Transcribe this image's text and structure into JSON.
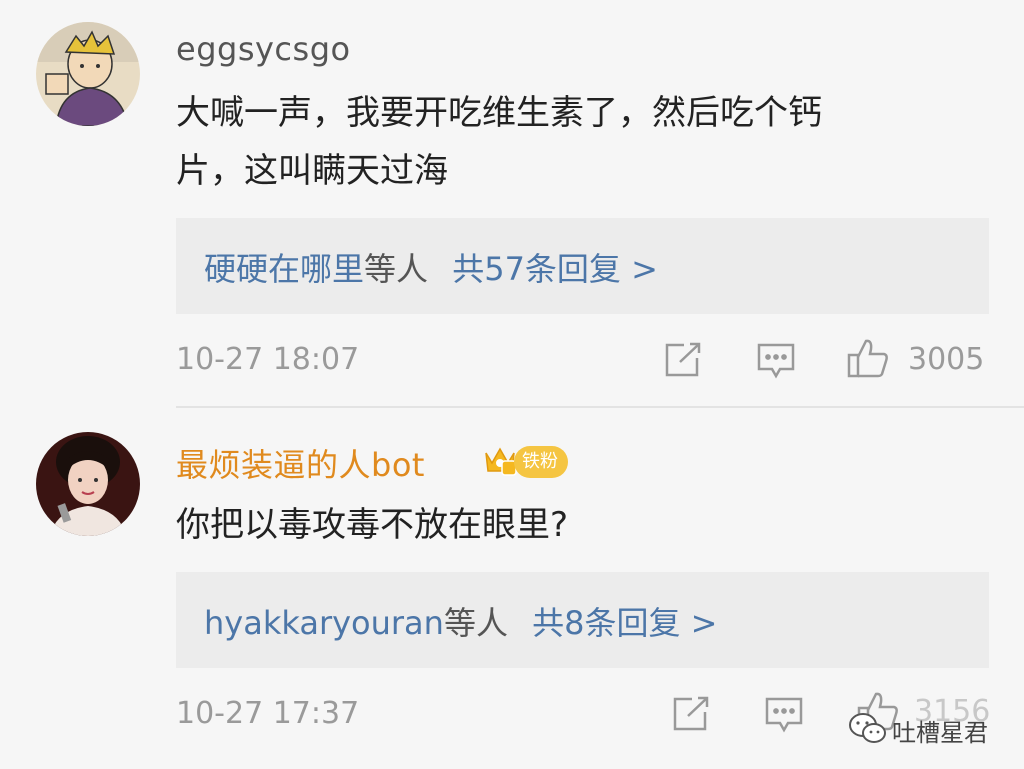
{
  "comments": [
    {
      "username": "eggsycsgo",
      "text_line1": "大喊一声，我要开吃维生素了，然后吃个钙",
      "text_line2": "片，这叫瞒天过海",
      "reply_users": "硬硬在哪里",
      "reply_mid": "等人",
      "reply_count": "共57条回复 >",
      "time": "10-27 18:07",
      "likes": "3005"
    },
    {
      "username": "最烦装逼的人bot",
      "badge": "铁粉",
      "text_line1": "你把以毒攻毒不放在眼里?",
      "reply_users": "hyakkaryouran",
      "reply_mid": "等人",
      "reply_count": "共8条回复 >",
      "time": "10-27 17:37",
      "likes": "3156"
    }
  ],
  "watermark": "吐槽星君",
  "colors": {
    "link": "#4c76a8",
    "username_highlight": "#e08a1e",
    "meta": "#9a9a9a"
  }
}
